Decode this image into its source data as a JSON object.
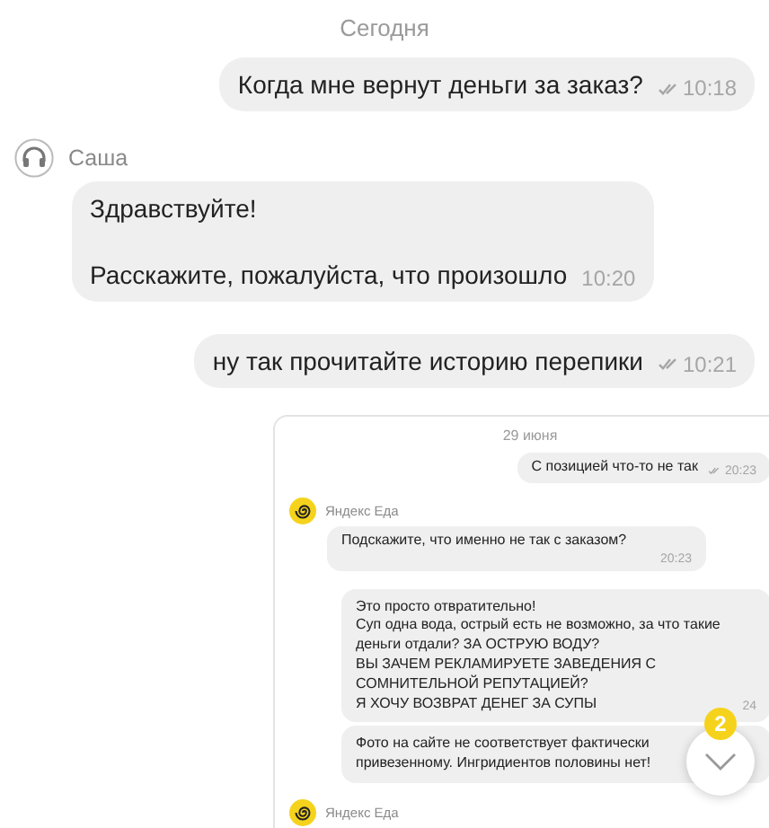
{
  "date_divider": "Сегодня",
  "messages": [
    {
      "kind": "outgoing",
      "text": "Когда мне вернут деньги за заказ?",
      "time": "10:18",
      "read": true
    },
    {
      "kind": "incoming",
      "sender": "Саша",
      "text": "Здравствуйте!\n\nРасскажите, пожалуйста, что произошло",
      "time": "10:20"
    },
    {
      "kind": "outgoing",
      "text": "ну так прочитайте историю перепики",
      "time": "10:21",
      "read": true
    },
    {
      "kind": "screenshot",
      "date_divider": "29 июня",
      "messages": [
        {
          "kind": "outgoing",
          "text": "С позицией что-то не так",
          "time": "20:23",
          "read": true
        },
        {
          "kind": "incoming",
          "sender": "Яндекс Еда",
          "text": "Подскажите, что именно не так с заказом?",
          "time": "20:23"
        },
        {
          "kind": "wide",
          "text": "Это просто отвратительно!\nСуп одна вода, острый есть не возможно, за что такие\nденьги отдали? ЗА ОСТРУЮ ВОДУ?\nВЫ ЗАЧЕМ РЕКЛАМИРУЕТЕ ЗАВЕДЕНИЯ С\nСОМНИТЕЛЬНОЙ РЕПУТАЦИЕЙ?\nЯ ХОЧУ ВОЗВРАТ ДЕНЕГ ЗА СУПЫ",
          "time": "24"
        },
        {
          "kind": "wide",
          "text": "Фото на сайте не соответствует фактически\nпривезенному. Ингридиентов половины нет!"
        },
        {
          "kind": "sender",
          "sender": "Яндекс Еда"
        }
      ]
    }
  ],
  "scroll_button": {
    "unread_count": "2"
  }
}
